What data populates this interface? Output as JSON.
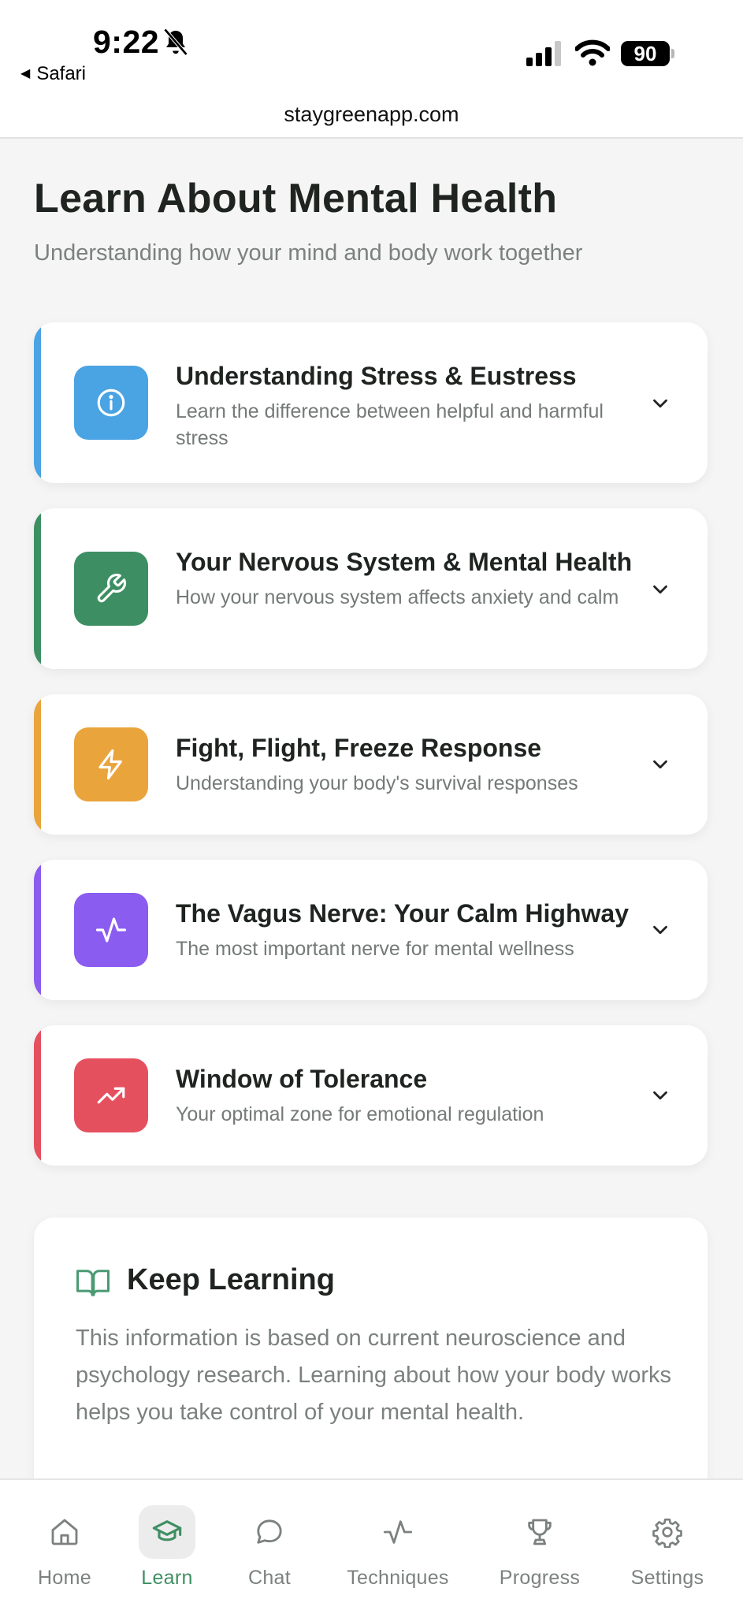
{
  "status_bar": {
    "time": "9:22",
    "back_app": "Safari",
    "battery": "90",
    "url": "staygreenapp.com"
  },
  "page": {
    "title": "Learn About Mental Health",
    "subtitle": "Understanding how your mind and body work together"
  },
  "topics": [
    {
      "title": "Understanding Stress & Eustress",
      "description": "Learn the difference between helpful and harmful stress",
      "icon": "info-icon",
      "color": "#4aa3e3"
    },
    {
      "title": "Your Nervous System & Mental Health",
      "description": "How your nervous system affects anxiety and calm",
      "icon": "wrench-icon",
      "color": "#3d8f63"
    },
    {
      "title": "Fight, Flight, Freeze Response",
      "description": "Understanding your body's survival responses",
      "icon": "lightning-icon",
      "color": "#e9a43c"
    },
    {
      "title": "The Vagus Nerve: Your Calm Highway",
      "description": "The most important nerve for mental wellness",
      "icon": "pulse-icon",
      "color": "#8b5cf0"
    },
    {
      "title": "Window of Tolerance",
      "description": "Your optimal zone for emotional regulation",
      "icon": "trending-up-icon",
      "color": "#e5505f"
    }
  ],
  "keep_learning": {
    "title": "Keep Learning",
    "text": "This information is based on current neuroscience and psychology research. Learning about how your body works helps you take control of your mental health.",
    "icon": "book-icon",
    "icon_color": "#4a9a73"
  },
  "nav": {
    "items": [
      {
        "label": "Home",
        "icon": "home-icon",
        "active": false
      },
      {
        "label": "Learn",
        "icon": "graduation-cap-icon",
        "active": true
      },
      {
        "label": "Chat",
        "icon": "chat-bubble-icon",
        "active": false
      },
      {
        "label": "Techniques",
        "icon": "pulse-icon",
        "active": false
      },
      {
        "label": "Progress",
        "icon": "trophy-icon",
        "active": false
      },
      {
        "label": "Settings",
        "icon": "gear-icon",
        "active": false
      }
    ],
    "active_color": "#3f8f63",
    "inactive_color": "#7b817e"
  }
}
